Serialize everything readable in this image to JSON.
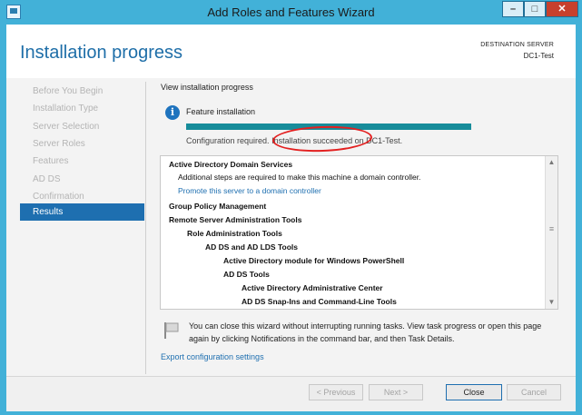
{
  "window": {
    "title": "Add Roles and Features Wizard",
    "controls": {
      "minimize": "–",
      "maximize": "□",
      "close": "✕"
    }
  },
  "header": {
    "page_title": "Installation progress",
    "destination_label": "DESTINATION SERVER",
    "destination_value": "DC1-Test"
  },
  "nav": {
    "items": [
      {
        "label": "Before You Begin",
        "active": false
      },
      {
        "label": "Installation Type",
        "active": false
      },
      {
        "label": "Server Selection",
        "active": false
      },
      {
        "label": "Server Roles",
        "active": false
      },
      {
        "label": "Features",
        "active": false
      },
      {
        "label": "AD DS",
        "active": false
      },
      {
        "label": "Confirmation",
        "active": false
      },
      {
        "label": "Results",
        "active": true
      }
    ]
  },
  "main": {
    "view_label": "View installation progress",
    "feature_installation": "Feature installation",
    "progress_fraction": 1.0,
    "progress_prefix": "Configuration required.",
    "progress_message": "Installation succeeded on DC1-Test.",
    "results": [
      {
        "text": "Active Directory Domain Services",
        "bold": true,
        "indent": 0
      },
      {
        "text": "Additional steps are required to make this machine a domain controller.",
        "bold": false,
        "indent": 1
      },
      {
        "text": "Promote this server to a domain controller",
        "bold": false,
        "indent": 1,
        "link": true
      },
      {
        "text": "Group Policy Management",
        "bold": true,
        "indent": 0
      },
      {
        "text": "Remote Server Administration Tools",
        "bold": true,
        "indent": 0
      },
      {
        "text": "Role Administration Tools",
        "bold": true,
        "indent": 1
      },
      {
        "text": "AD DS and AD LDS Tools",
        "bold": true,
        "indent": 2
      },
      {
        "text": "Active Directory module for Windows PowerShell",
        "bold": true,
        "indent": 3
      },
      {
        "text": "AD DS Tools",
        "bold": true,
        "indent": 3
      },
      {
        "text": "Active Directory Administrative Center",
        "bold": true,
        "indent": 4
      },
      {
        "text": "AD DS Snap-Ins and Command-Line Tools",
        "bold": true,
        "indent": 4
      }
    ],
    "note": "You can close this wizard without interrupting running tasks. View task progress or open this page again by clicking Notifications in the command bar, and then Task Details.",
    "export_link": "Export configuration settings"
  },
  "footer": {
    "previous": "< Previous",
    "next": "Next >",
    "close": "Close",
    "cancel": "Cancel"
  },
  "colors": {
    "titlebar": "#42b1d8",
    "accent": "#1e6fb0",
    "progress": "#178c9a",
    "annotation": "#e32020"
  }
}
